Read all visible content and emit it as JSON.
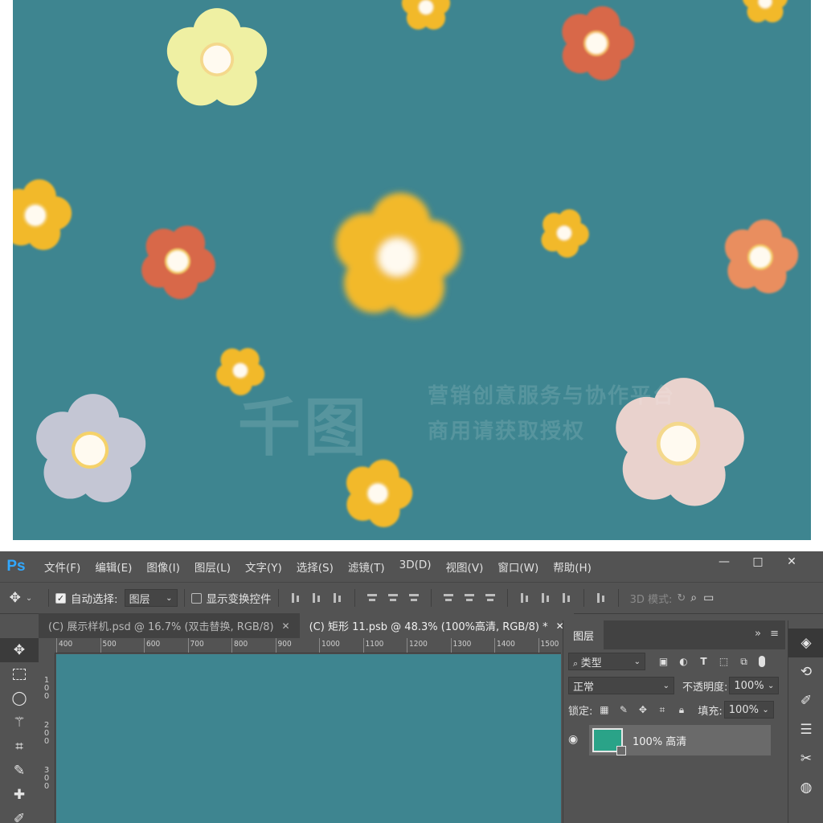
{
  "artwork": {
    "background": "#3e8590",
    "watermark": {
      "logo": "千图",
      "line1": "营销创意服务与协作平台",
      "line2": "商用请获取授权"
    }
  },
  "app": {
    "logo": "Ps"
  },
  "menu": [
    "文件(F)",
    "编辑(E)",
    "图像(I)",
    "图层(L)",
    "文字(Y)",
    "选择(S)",
    "滤镜(T)",
    "3D(D)",
    "视图(V)",
    "窗口(W)",
    "帮助(H)"
  ],
  "window_controls": {
    "minimize": "—",
    "maximize": "□",
    "close": "✕"
  },
  "options": {
    "auto_select_label": "自动选择:",
    "auto_select_checked": true,
    "auto_select_target": "图层",
    "show_transform_label": "显示变换控件",
    "show_transform_checked": false,
    "mode_3d_label": "3D 模式:"
  },
  "tabs": [
    {
      "label": "(C) 展示样机.psd @ 16.7% (双击替换, RGB/8)",
      "active": false
    },
    {
      "label": "(C) 矩形 11.psb @ 48.3% (100%高清, RGB/8) *",
      "active": true
    }
  ],
  "tools": [
    "move-tool",
    "marquee-tool",
    "lasso-tool",
    "magic-wand-tool",
    "crop-tool",
    "eyedropper-tool",
    "healing-brush-tool",
    "brush-tool"
  ],
  "ruler": {
    "top": [
      "400",
      "500",
      "600",
      "700",
      "800",
      "900",
      "1000",
      "1100",
      "1200",
      "1300",
      "1400",
      "1500"
    ],
    "left": [
      "100",
      "200",
      "300"
    ]
  },
  "layers_panel": {
    "title": "图层",
    "filter_label": "类型",
    "blend_mode": "正常",
    "opacity_label": "不透明度:",
    "opacity_value": "100%",
    "lock_label": "锁定:",
    "fill_label": "填充:",
    "fill_value": "100%",
    "layers": [
      {
        "name": "100% 高清",
        "visible": true,
        "thumb_color": "#2aa388"
      }
    ]
  }
}
